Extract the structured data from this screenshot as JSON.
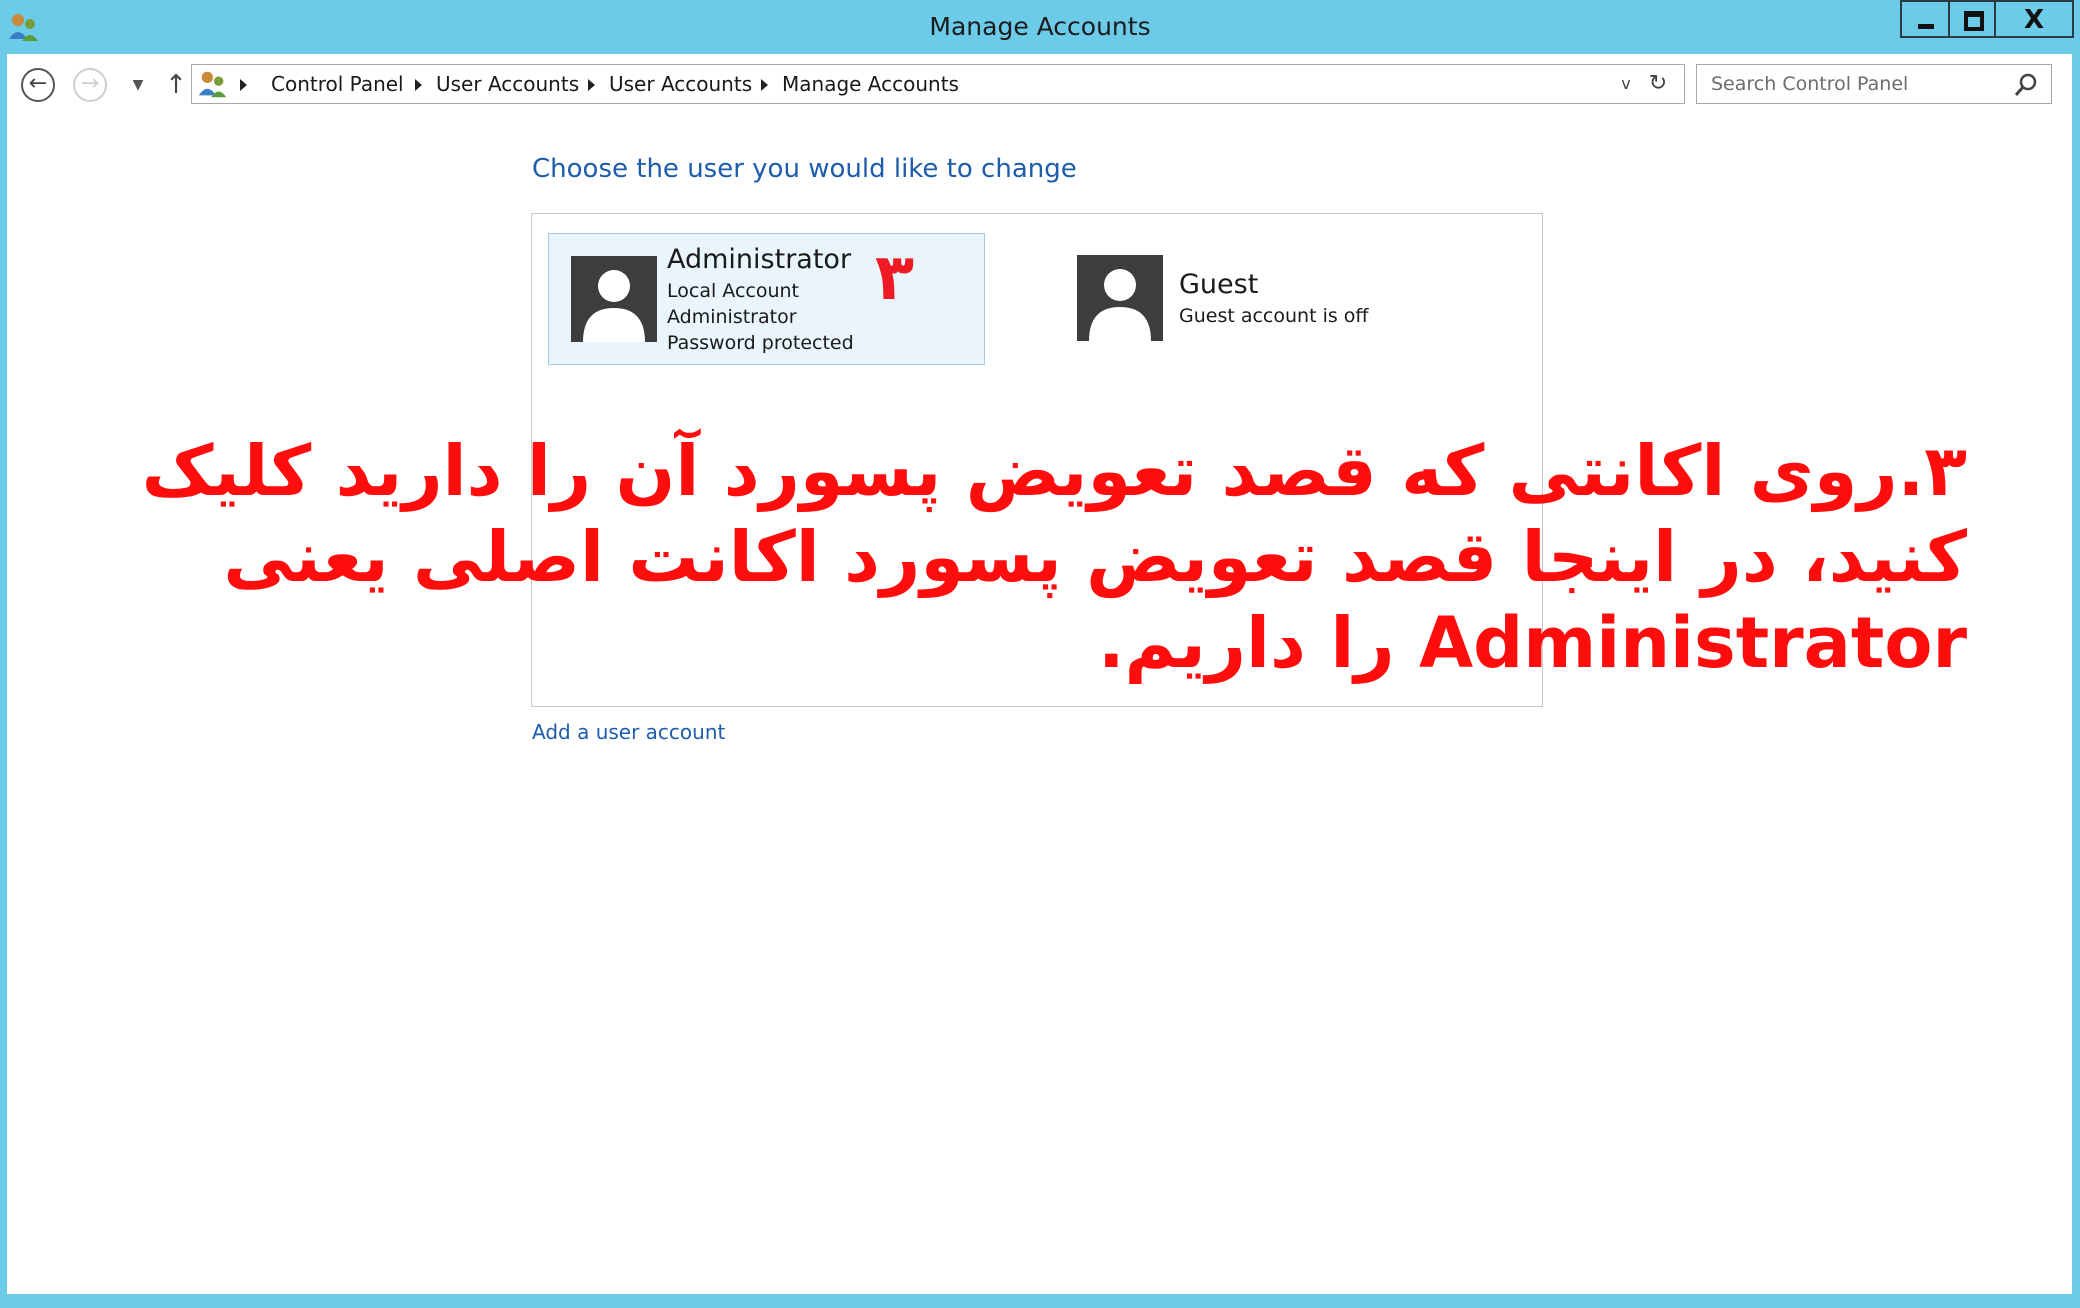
{
  "window": {
    "title": "Manage Accounts",
    "close_symbol": "X"
  },
  "nav": {
    "back_symbol": "←",
    "forward_symbol": "→",
    "history_symbol": "▼",
    "up_symbol": "↑",
    "breadcrumb": [
      "Control Panel",
      "User Accounts",
      "User Accounts",
      "Manage Accounts"
    ],
    "dropdown_symbol": "v",
    "refresh_symbol": "↻",
    "search_placeholder": "Search Control Panel"
  },
  "main": {
    "heading": "Choose the user you would like to change",
    "accounts": [
      {
        "name": "Administrator",
        "lines": [
          "Local Account",
          "Administrator",
          "Password protected"
        ]
      },
      {
        "name": "Guest",
        "lines": [
          "Guest account is off"
        ]
      }
    ],
    "add_link": "Add a user account"
  },
  "annotation": {
    "step_number": "۳",
    "text": "۳.روی اکانتی که قصد تعویض پسورد آن را دارید کلیک کنید، در اینجا قصد تعویض پسورد اکانت اصلی یعنی Administrator را داریم."
  },
  "colors": {
    "title_bar": "#6ccbe9",
    "link_blue": "#1e5dab",
    "annotation_red": "#ff0d0d",
    "selected_card": "#eaf4fb"
  },
  "icons": [
    "user-accounts-icon",
    "back-arrow-icon",
    "forward-arrow-icon",
    "up-arrow-icon",
    "search-icon",
    "user-avatar-icon"
  ]
}
